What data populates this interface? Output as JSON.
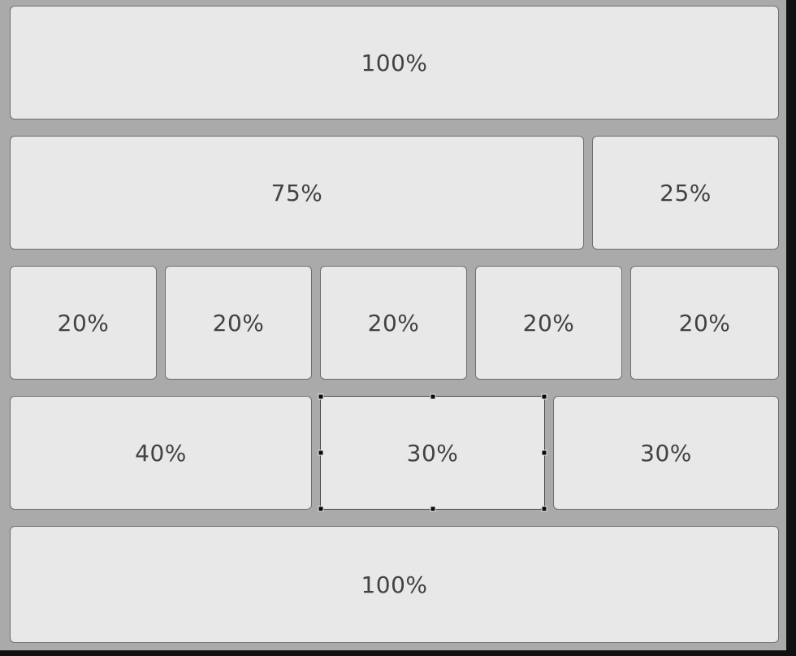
{
  "rows": [
    {
      "tiles": [
        {
          "label": "100%"
        }
      ]
    },
    {
      "tiles": [
        {
          "label": "75%"
        },
        {
          "label": "25%"
        }
      ]
    },
    {
      "tiles": [
        {
          "label": "20%"
        },
        {
          "label": "20%"
        },
        {
          "label": "20%"
        },
        {
          "label": "20%"
        },
        {
          "label": "20%"
        }
      ]
    },
    {
      "tiles": [
        {
          "label": "40%"
        },
        {
          "label": "30%",
          "selected": true
        },
        {
          "label": "30%"
        }
      ]
    },
    {
      "tiles": [
        {
          "label": "100%"
        }
      ]
    }
  ],
  "colors": {
    "canvas_background": "#aaaaaa",
    "tile_background": "#e8e8e8",
    "tile_border": "#6e6e6e",
    "label_text": "#424242",
    "selection_handle": "#0a0a0a"
  }
}
